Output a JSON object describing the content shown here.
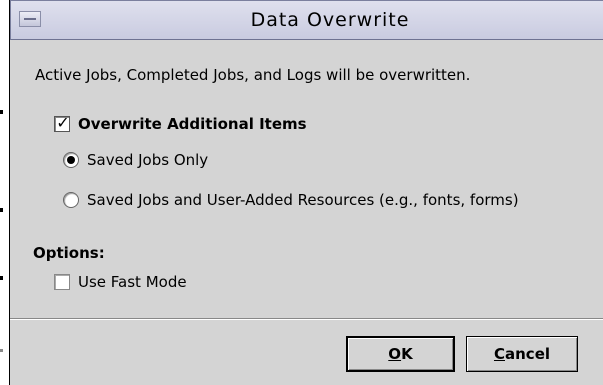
{
  "window": {
    "title": "Data Overwrite",
    "menu_icon": "window-menu-icon"
  },
  "message": "Active Jobs, Completed Jobs, and Logs will be overwritten.",
  "overwrite_additional": {
    "label": "Overwrite Additional Items",
    "checked": true,
    "options": [
      {
        "label": "Saved Jobs Only",
        "selected": true
      },
      {
        "label": "Saved Jobs and User-Added Resources (e.g., fonts, forms)",
        "selected": false
      }
    ]
  },
  "options_section": {
    "label": "Options:",
    "fast_mode": {
      "label": "Use Fast Mode",
      "checked": false
    }
  },
  "buttons": {
    "ok": {
      "mnemonic": "O",
      "rest": "K"
    },
    "cancel": {
      "mnemonic": "C",
      "rest": "ancel"
    }
  }
}
